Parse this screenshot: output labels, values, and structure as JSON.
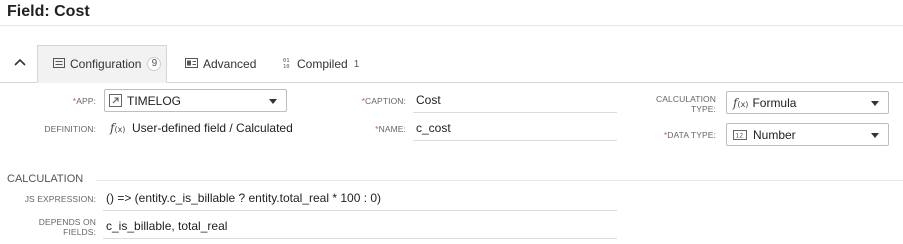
{
  "header": {
    "title": "Field: Cost"
  },
  "tabs": [
    {
      "label": "Configuration",
      "badge": "9",
      "icon": "list-icon"
    },
    {
      "label": "Advanced",
      "icon": "id-card-icon"
    },
    {
      "label": "Compiled",
      "badge": "1",
      "icon": "binary-icon"
    }
  ],
  "form": {
    "required_mark": "*",
    "app": {
      "label": "APP:",
      "value": "TIMELOG",
      "icon": "external-link-icon"
    },
    "definition": {
      "label": "DEFINITION:",
      "icon": "fx-icon",
      "value": "User-defined field / Calculated"
    },
    "caption": {
      "label": "CAPTION:",
      "value": "Cost"
    },
    "name": {
      "label": "NAME:",
      "value": "c_cost"
    },
    "calculation_type": {
      "label_line1": "CALCULATION",
      "label_line2": "TYPE:",
      "value": "Formula",
      "icon": "fx-icon"
    },
    "data_type": {
      "label": "DATA TYPE:",
      "value": "Number",
      "icon": "number-icon"
    }
  },
  "calculation": {
    "section_title": "CALCULATION",
    "js_expression": {
      "label": "JS EXPRESSION:",
      "value": "() => (entity.c_is_billable ? entity.total_real * 100 : 0)"
    },
    "depends_on": {
      "label_line1": "DEPENDS ON",
      "label_line2": "FIELDS:",
      "value": "c_is_billable, total_real"
    }
  },
  "colors": {
    "required": "#d9534f",
    "tab_active_bg": "#f2f2f2"
  }
}
